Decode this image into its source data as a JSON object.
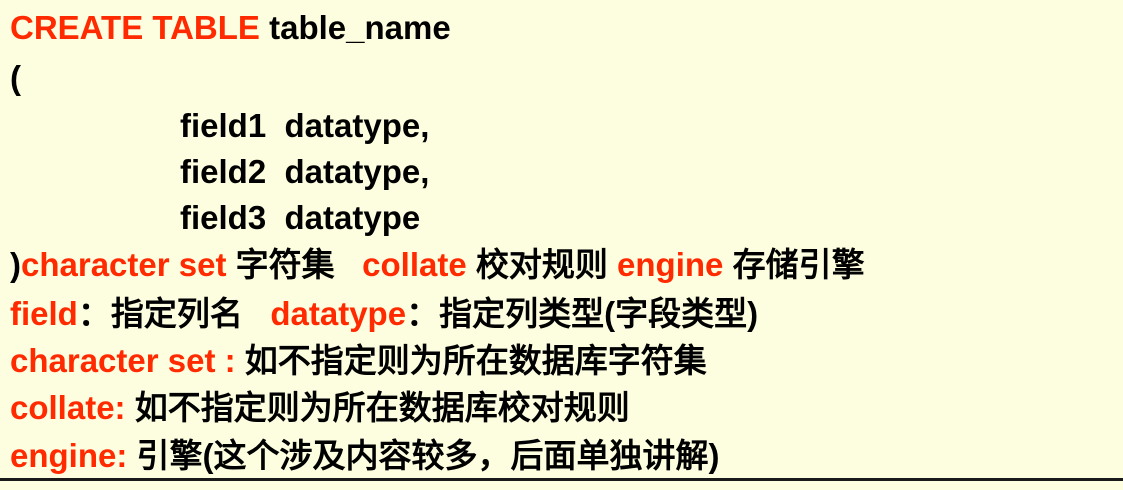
{
  "syntax": {
    "create_kw": "CREATE TABLE",
    "table_name": " table_name",
    "open_paren": "(",
    "fields": [
      "field1  datatype,",
      "field2  datatype,",
      "field3  datatype"
    ],
    "close_paren": ")",
    "charset_kw": "character set",
    "charset_val": " 字符集   ",
    "collate_kw": "collate",
    "collate_val": " 校对规则 ",
    "engine_kw": "engine",
    "engine_val": " 存储引擎"
  },
  "notes": {
    "field_kw": "field",
    "field_desc": "：指定列名   ",
    "datatype_kw": "datatype",
    "datatype_desc": "：指定列类型(字段类型)",
    "charset_kw": "character set :",
    "charset_desc": " 如不指定则为所在数据库字符集",
    "collate_kw": "collate:",
    "collate_desc": " 如不指定则为所在数据库校对规则",
    "engine_kw": "engine:",
    "engine_desc": " 引擎(这个涉及内容较多，后面单独讲解)"
  },
  "colors": {
    "keyword": "#ff2a00",
    "text": "#000000",
    "background": "#fdfde0"
  }
}
